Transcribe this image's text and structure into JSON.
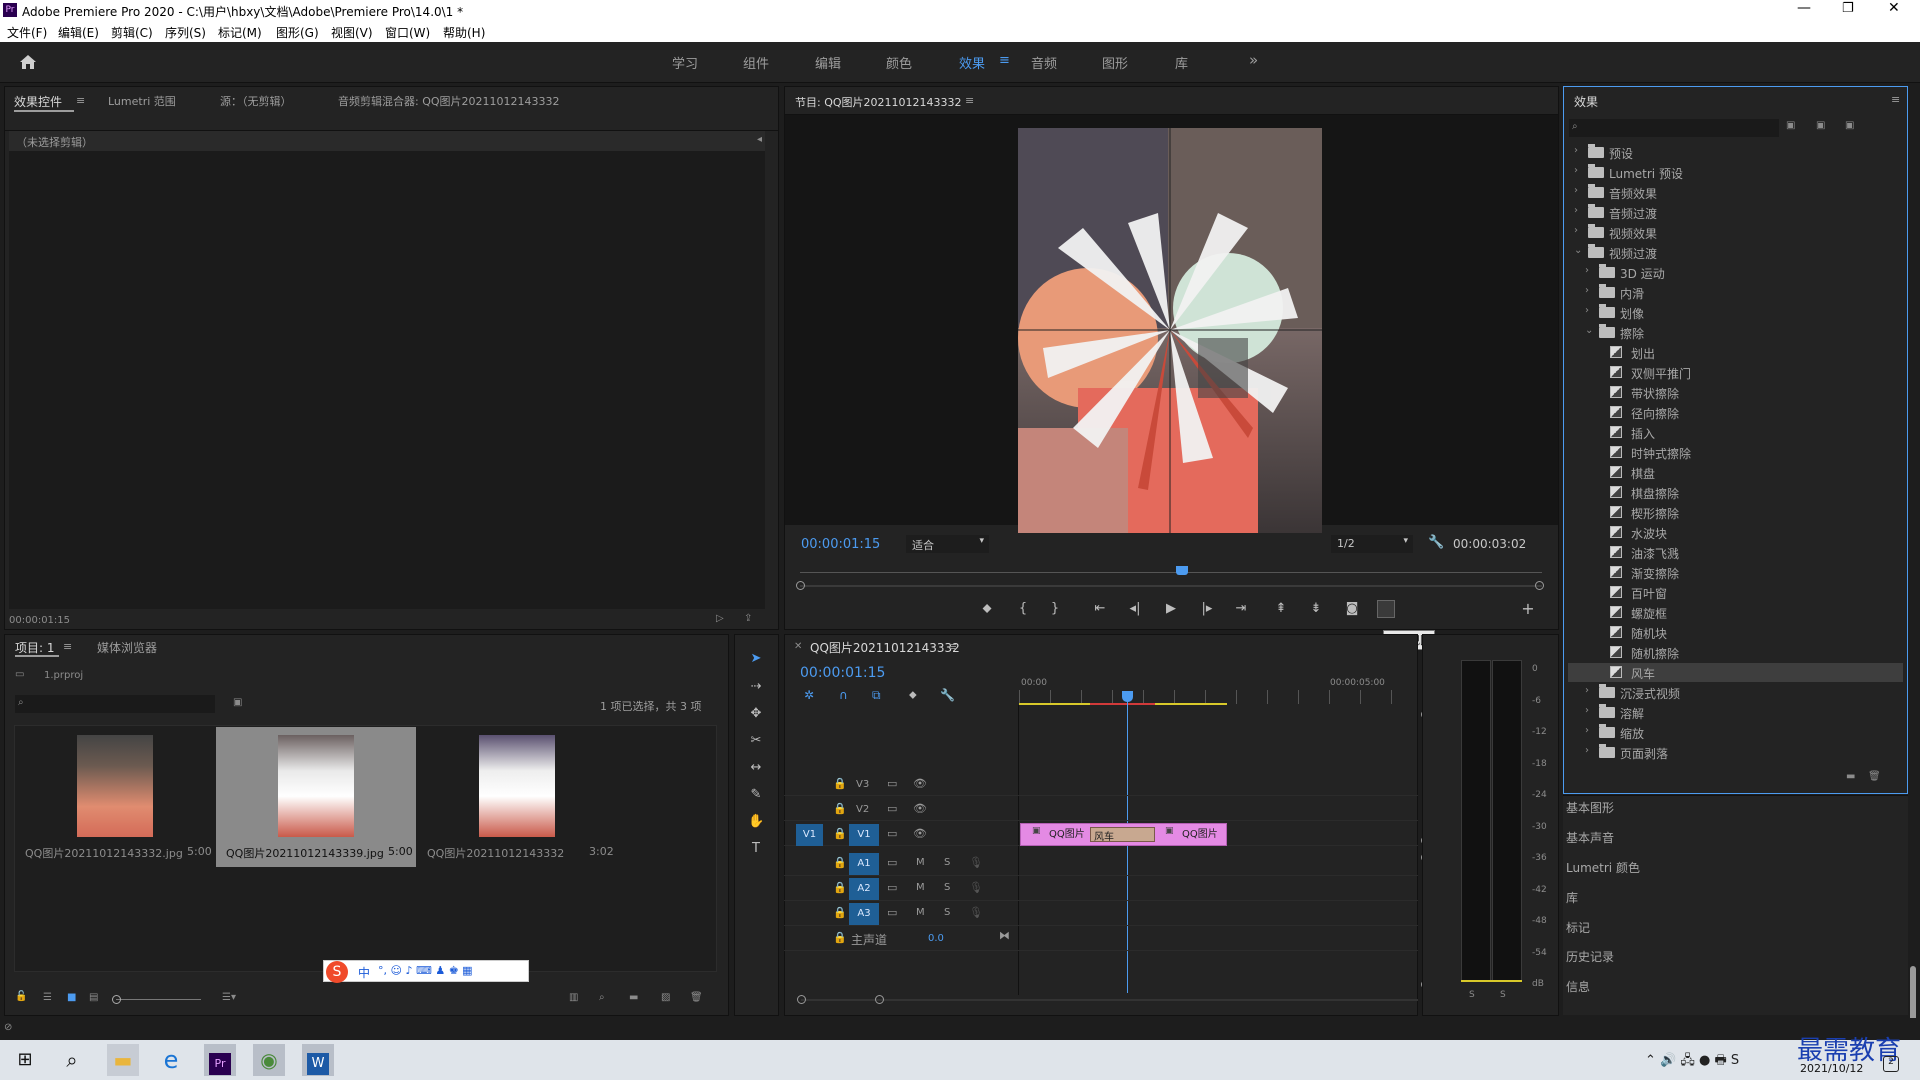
{
  "window": {
    "title": "Adobe Premiere Pro 2020 - C:\\用户\\hbxy\\文档\\Adobe\\Premiere Pro\\14.0\\1 *"
  },
  "menu": [
    "文件(F)",
    "编辑(E)",
    "剪辑(C)",
    "序列(S)",
    "标记(M)",
    "图形(G)",
    "视图(V)",
    "窗口(W)",
    "帮助(H)"
  ],
  "workspaces": [
    "学习",
    "组件",
    "编辑",
    "颜色",
    "效果",
    "音频",
    "图形",
    "库"
  ],
  "active_workspace": "效果",
  "source_panel": {
    "tabs": [
      "效果控件",
      "Lumetri 范围",
      "源：（无剪辑）",
      "音频剪辑混合器: QQ图片20211012143332"
    ],
    "empty_label": "（未选择剪辑）",
    "timecode": "00:00:01:15"
  },
  "program_monitor": {
    "title": "节目: QQ图片20211012143332",
    "timecode": "00:00:01:15",
    "fit": "适合",
    "resolution": "1/2",
    "duration": "00:00:03:02",
    "tooltip": "比较视图"
  },
  "project_panel": {
    "tabs": [
      "项目: 1",
      "媒体浏览器"
    ],
    "project_file": "1.prproj",
    "selection_status": "1 项已选择，共 3 项",
    "items": [
      {
        "name": "QQ图片20211012143332.jpg",
        "duration": "5:00"
      },
      {
        "name": "QQ图片20211012143339.jpg",
        "duration": "5:00"
      },
      {
        "name": "QQ图片20211012143332",
        "duration": "3:02"
      }
    ]
  },
  "ime": {
    "label": "中"
  },
  "timeline": {
    "tab": "QQ图片20211012143332",
    "timecode": "00:00:01:15",
    "ruler": [
      "00:00",
      "00:00:05:00"
    ],
    "video_tracks": [
      "V3",
      "V2",
      "V1"
    ],
    "audio_tracks": [
      "A1",
      "A2",
      "A3"
    ],
    "source_patch": "V1",
    "master_label": "主声道",
    "master_value": "0.0",
    "clips": [
      {
        "label": "QQ图片"
      },
      {
        "label": "风车"
      },
      {
        "label": "QQ图片"
      }
    ],
    "track_buttons": {
      "mute": "M",
      "solo": "S"
    }
  },
  "meter": {
    "scale": [
      "0",
      "-6",
      "-12",
      "-18",
      "-24",
      "-30",
      "-36",
      "-42",
      "-48",
      "-54",
      "dB"
    ],
    "solo": [
      "S",
      "S"
    ]
  },
  "effects_panel": {
    "title": "效果",
    "tree": [
      {
        "level": 0,
        "type": "folder",
        "label": "预设",
        "open": false
      },
      {
        "level": 0,
        "type": "folder",
        "label": "Lumetri 预设",
        "open": false
      },
      {
        "level": 0,
        "type": "folder",
        "label": "音频效果",
        "open": false
      },
      {
        "level": 0,
        "type": "folder",
        "label": "音频过渡",
        "open": false
      },
      {
        "level": 0,
        "type": "folder",
        "label": "视频效果",
        "open": false
      },
      {
        "level": 0,
        "type": "folder",
        "label": "视频过渡",
        "open": true
      },
      {
        "level": 1,
        "type": "folder",
        "label": "3D 运动",
        "open": false
      },
      {
        "level": 1,
        "type": "folder",
        "label": "内滑",
        "open": false
      },
      {
        "level": 1,
        "type": "folder",
        "label": "划像",
        "open": false
      },
      {
        "level": 1,
        "type": "folder",
        "label": "擦除",
        "open": true
      },
      {
        "level": 2,
        "type": "fx",
        "label": "划出"
      },
      {
        "level": 2,
        "type": "fx",
        "label": "双侧平推门"
      },
      {
        "level": 2,
        "type": "fx",
        "label": "带状擦除"
      },
      {
        "level": 2,
        "type": "fx",
        "label": "径向擦除"
      },
      {
        "level": 2,
        "type": "fx",
        "label": "插入"
      },
      {
        "level": 2,
        "type": "fx",
        "label": "时钟式擦除"
      },
      {
        "level": 2,
        "type": "fx",
        "label": "棋盘"
      },
      {
        "level": 2,
        "type": "fx",
        "label": "棋盘擦除"
      },
      {
        "level": 2,
        "type": "fx",
        "label": "楔形擦除"
      },
      {
        "level": 2,
        "type": "fx",
        "label": "水波块"
      },
      {
        "level": 2,
        "type": "fx",
        "label": "油漆飞溅"
      },
      {
        "level": 2,
        "type": "fx",
        "label": "渐变擦除"
      },
      {
        "level": 2,
        "type": "fx",
        "label": "百叶窗"
      },
      {
        "level": 2,
        "type": "fx",
        "label": "螺旋框"
      },
      {
        "level": 2,
        "type": "fx",
        "label": "随机块"
      },
      {
        "level": 2,
        "type": "fx",
        "label": "随机擦除"
      },
      {
        "level": 2,
        "type": "fx",
        "label": "风车",
        "selected": true
      },
      {
        "level": 1,
        "type": "folder",
        "label": "沉浸式视频",
        "open": false
      },
      {
        "level": 1,
        "type": "folder",
        "label": "溶解",
        "open": false
      },
      {
        "level": 1,
        "type": "folder",
        "label": "缩放",
        "open": false
      },
      {
        "level": 1,
        "type": "folder",
        "label": "页面剥落",
        "open": false
      }
    ]
  },
  "side_panels": [
    "基本图形",
    "基本声音",
    "Lumetri 颜色",
    "库",
    "标记",
    "历史记录",
    "信息"
  ],
  "taskbar": {
    "date": "2021/10/12",
    "watermark": "最需教育"
  }
}
